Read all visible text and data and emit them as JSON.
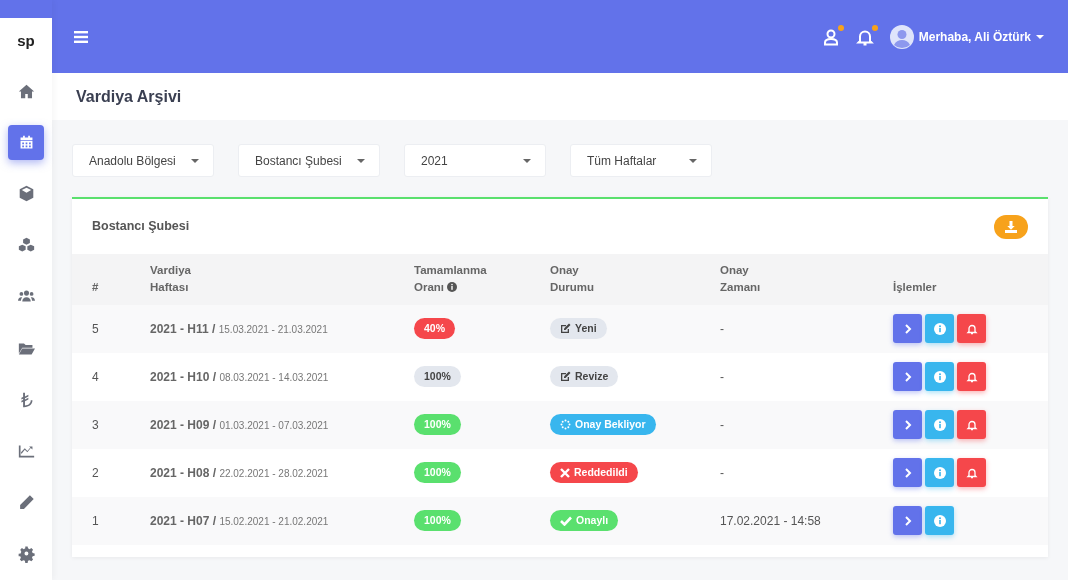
{
  "sidebar": {
    "logo": "sp",
    "items": [
      {
        "kind": "home",
        "selected": false
      },
      {
        "kind": "calendar",
        "selected": true
      },
      {
        "kind": "cube",
        "selected": false
      },
      {
        "kind": "cubes",
        "selected": false
      },
      {
        "kind": "users",
        "selected": false
      },
      {
        "kind": "folder",
        "selected": false
      },
      {
        "kind": "lira",
        "selected": false
      },
      {
        "kind": "chart",
        "selected": false
      },
      {
        "kind": "pencil",
        "selected": false
      },
      {
        "kind": "gear",
        "selected": false
      }
    ]
  },
  "header": {
    "icons": [
      {
        "kind": "user",
        "badge": true
      },
      {
        "kind": "bell",
        "badge": true
      }
    ],
    "greeting": "Merhaba, Ali Öztürk"
  },
  "page_title": "Vardiya Arşivi",
  "filters": [
    {
      "value": "Anadolu Bölgesi"
    },
    {
      "value": "Bostancı Şubesi"
    },
    {
      "value": "2021"
    },
    {
      "value": "Tüm Haftalar"
    }
  ],
  "card": {
    "title": "Bostancı Şubesi",
    "columns": [
      {
        "label": "#"
      },
      {
        "label": "Vardiya Haftası"
      },
      {
        "label": "Tamamlanma Oranı",
        "info": true
      },
      {
        "label": "Onay Durumu"
      },
      {
        "label": "Onay Zamanı"
      },
      {
        "label": "İşlemler"
      }
    ],
    "rows": [
      {
        "number": "5",
        "week": "2021 - H11 /",
        "dates": "15.03.2021 - 21.03.2021",
        "completion": "40%",
        "color": "#f5474b",
        "status": {
          "kind": "new",
          "label": "Yeni"
        },
        "approval_time": "-",
        "actions": [
          {
            "kind": "open"
          },
          {
            "kind": "info"
          },
          {
            "kind": "notify"
          }
        ]
      },
      {
        "number": "4",
        "week": "2021 - H10 /",
        "dates": "08.03.2021 - 14.03.2021",
        "completion": "100%",
        "color": "#e3e7ee",
        "status": {
          "kind": "revise",
          "label": "Revize"
        },
        "approval_time": "-",
        "actions": [
          {
            "kind": "open"
          },
          {
            "kind": "info"
          },
          {
            "kind": "notify"
          }
        ]
      },
      {
        "number": "3",
        "week": "2021 - H09 /",
        "dates": "01.03.2021 - 07.03.2021",
        "completion": "100%",
        "color": "#5ae06e",
        "status": {
          "kind": "pending",
          "label": "Onay Bekliyor"
        },
        "approval_time": "-",
        "actions": [
          {
            "kind": "open"
          },
          {
            "kind": "info"
          },
          {
            "kind": "notify"
          }
        ]
      },
      {
        "number": "2",
        "week": "2021 - H08 /",
        "dates": "22.02.2021 - 28.02.2021",
        "completion": "100%",
        "color": "#5ae06e",
        "status": {
          "kind": "rejected",
          "label": "Reddedildi"
        },
        "approval_time": "-",
        "actions": [
          {
            "kind": "open"
          },
          {
            "kind": "info"
          },
          {
            "kind": "notify"
          }
        ]
      },
      {
        "number": "1",
        "week": "2021 - H07 /",
        "dates": "15.02.2021 - 21.02.2021",
        "completion": "100%",
        "color": "#5ae06e",
        "status": {
          "kind": "approved",
          "label": "Onaylı"
        },
        "approval_time": "17.02.2021 - 14:58",
        "actions": [
          {
            "kind": "open"
          },
          {
            "kind": "info"
          }
        ]
      }
    ]
  }
}
